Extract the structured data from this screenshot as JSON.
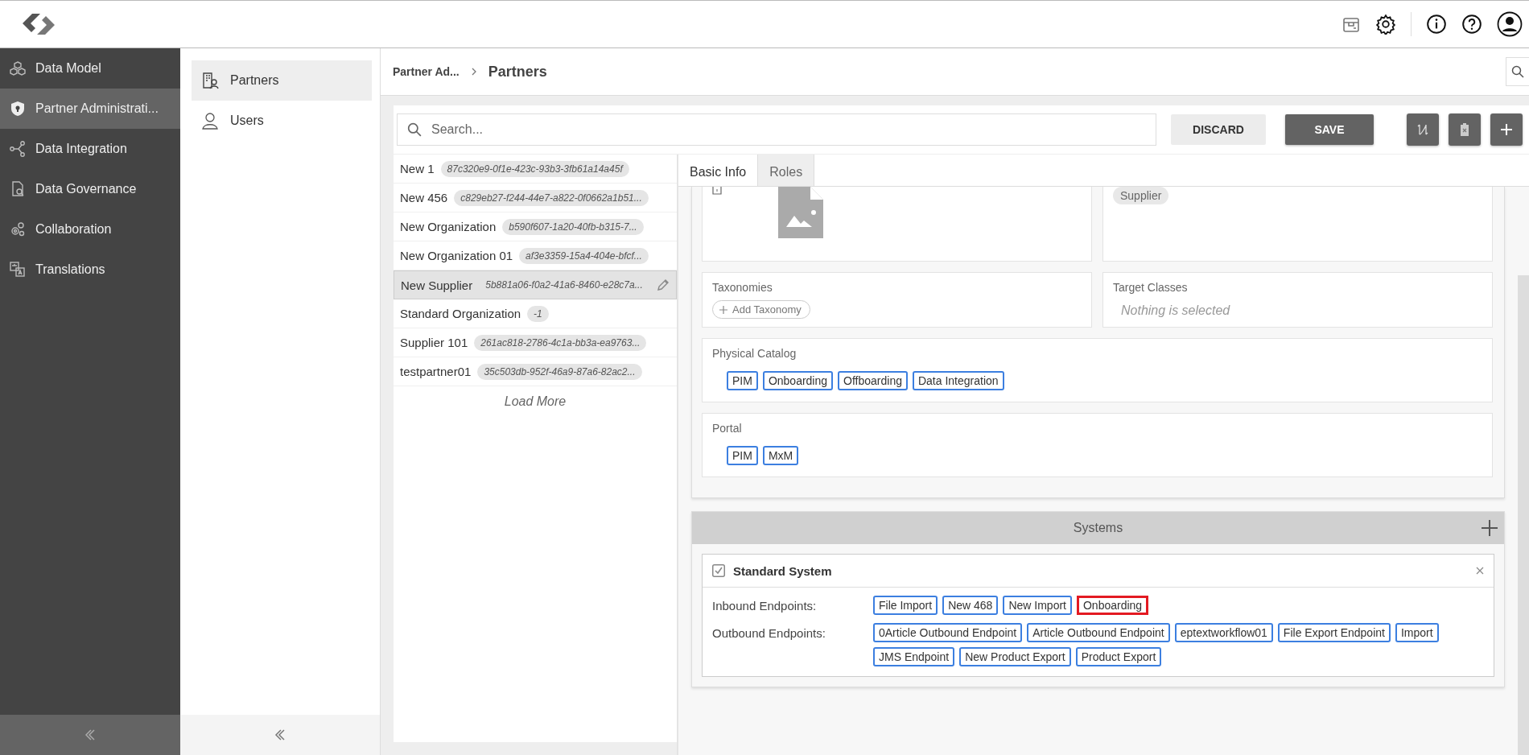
{
  "nav": [
    {
      "label": "Data Model",
      "selected": false
    },
    {
      "label": "Partner Administrati...",
      "selected": true
    },
    {
      "label": "Data Integration",
      "selected": false
    },
    {
      "label": "Data Governance",
      "selected": false
    },
    {
      "label": "Collaboration",
      "selected": false
    },
    {
      "label": "Translations",
      "selected": false
    }
  ],
  "subnav": [
    {
      "label": "Partners",
      "selected": true
    },
    {
      "label": "Users",
      "selected": false
    }
  ],
  "breadcrumb": {
    "parent": "Partner Ad...",
    "current": "Partners"
  },
  "search": {
    "placeholder": "Search..."
  },
  "buttons": [
    {
      "label": "DISCARD",
      "kind": "secondary"
    },
    {
      "label": "SAVE",
      "kind": "primary"
    }
  ],
  "partners": [
    {
      "name": "New 1",
      "id": "87c320e9-0f1e-423c-93b3-3fb61a14a45f",
      "selected": false
    },
    {
      "name": "New 456",
      "id": "c829eb27-f244-44e7-a822-0f0662a1b51...",
      "selected": false
    },
    {
      "name": "New Organization",
      "id": "b590f607-1a20-40fb-b315-7...",
      "selected": false
    },
    {
      "name": "New Organization 01",
      "id": "af3e3359-15a4-404e-bfcf...",
      "selected": false
    },
    {
      "name": "New Supplier",
      "id": "5b881a06-f0a2-41a6-8460-e28c7a...",
      "selected": true
    },
    {
      "name": "Standard Organization",
      "id": "-1",
      "selected": false
    },
    {
      "name": "Supplier 101",
      "id": "261ac818-2786-4c1a-bb3a-ea9763...",
      "selected": false
    },
    {
      "name": "testpartner01",
      "id": "35c503db-952f-46a9-87a6-82ac2...",
      "selected": false
    }
  ],
  "load_more": "Load More",
  "tabs": [
    {
      "label": "Basic Info",
      "selected": true
    },
    {
      "label": "Roles",
      "selected": false
    }
  ],
  "form": {
    "type_chip": "Supplier",
    "taxonomies": {
      "label": "Taxonomies",
      "button": "Add Taxonomy"
    },
    "target_classes": {
      "label": "Target Classes",
      "placeholder": "Nothing is selected"
    },
    "physical_catalog": {
      "label": "Physical Catalog",
      "tags": [
        "PIM",
        "Onboarding",
        "Offboarding",
        "Data Integration"
      ]
    },
    "portal": {
      "label": "Portal",
      "tags": [
        "PIM",
        "MxM"
      ]
    }
  },
  "systems": {
    "title": "Systems",
    "items": [
      {
        "name": "Standard System",
        "checked": true,
        "inbound_label": "Inbound Endpoints:",
        "inbound": [
          {
            "label": "File Import",
            "highlighted": false
          },
          {
            "label": "New 468",
            "highlighted": false
          },
          {
            "label": "New Import",
            "highlighted": false
          },
          {
            "label": "Onboarding",
            "highlighted": true
          }
        ],
        "outbound_label": "Outbound Endpoints:",
        "outbound": [
          {
            "label": "0Article Outbound Endpoint",
            "highlighted": false
          },
          {
            "label": "Article Outbound Endpoint",
            "highlighted": false
          },
          {
            "label": "eptextworkflow01",
            "highlighted": false
          },
          {
            "label": "File Export Endpoint",
            "highlighted": false
          },
          {
            "label": "Import",
            "highlighted": false
          },
          {
            "label": "JMS Endpoint",
            "highlighted": false
          },
          {
            "label": "New Product Export",
            "highlighted": false
          },
          {
            "label": "Product Export",
            "highlighted": false
          }
        ]
      }
    ]
  }
}
